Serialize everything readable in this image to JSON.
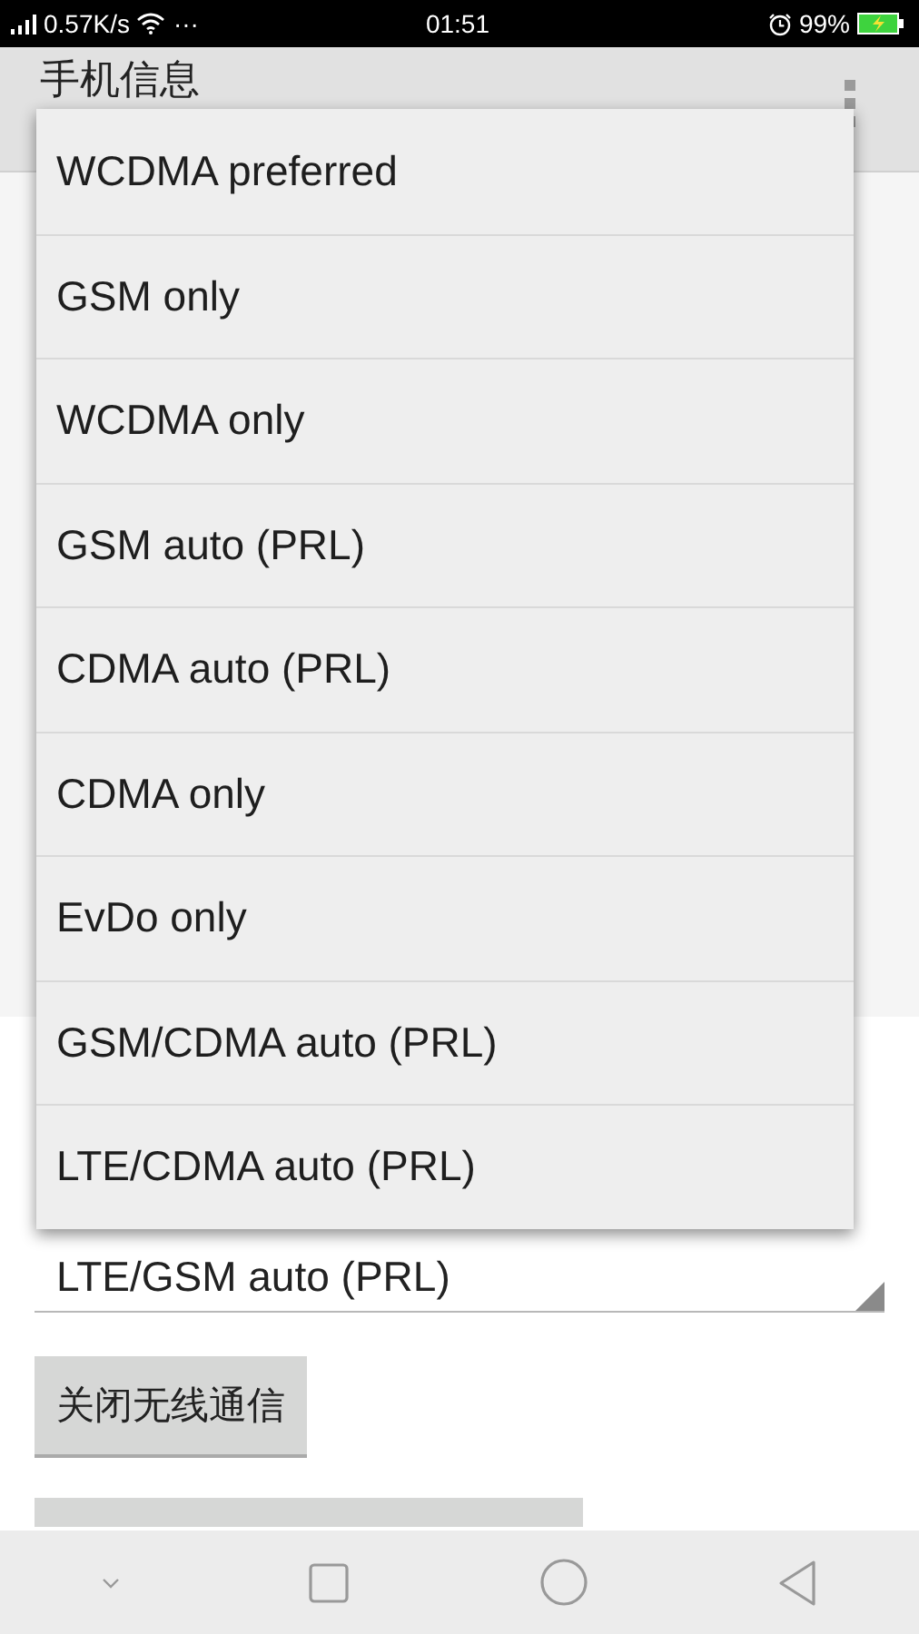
{
  "status_bar": {
    "speed": "0.57K/s",
    "more": "···",
    "time": "01:51",
    "battery": "99%"
  },
  "app_bar": {
    "title": "手机信息"
  },
  "dropdown": {
    "options": [
      {
        "label": "WCDMA preferred"
      },
      {
        "label": "GSM only"
      },
      {
        "label": "WCDMA only"
      },
      {
        "label": "GSM auto (PRL)"
      },
      {
        "label": "CDMA auto (PRL)"
      },
      {
        "label": "CDMA only"
      },
      {
        "label": "EvDo only"
      },
      {
        "label": "GSM/CDMA auto (PRL)"
      },
      {
        "label": "LTE/CDMA auto (PRL)"
      }
    ]
  },
  "network_spinner": {
    "value": "LTE/GSM auto (PRL)"
  },
  "buttons": [
    {
      "label": "关闭无线通信"
    }
  ]
}
